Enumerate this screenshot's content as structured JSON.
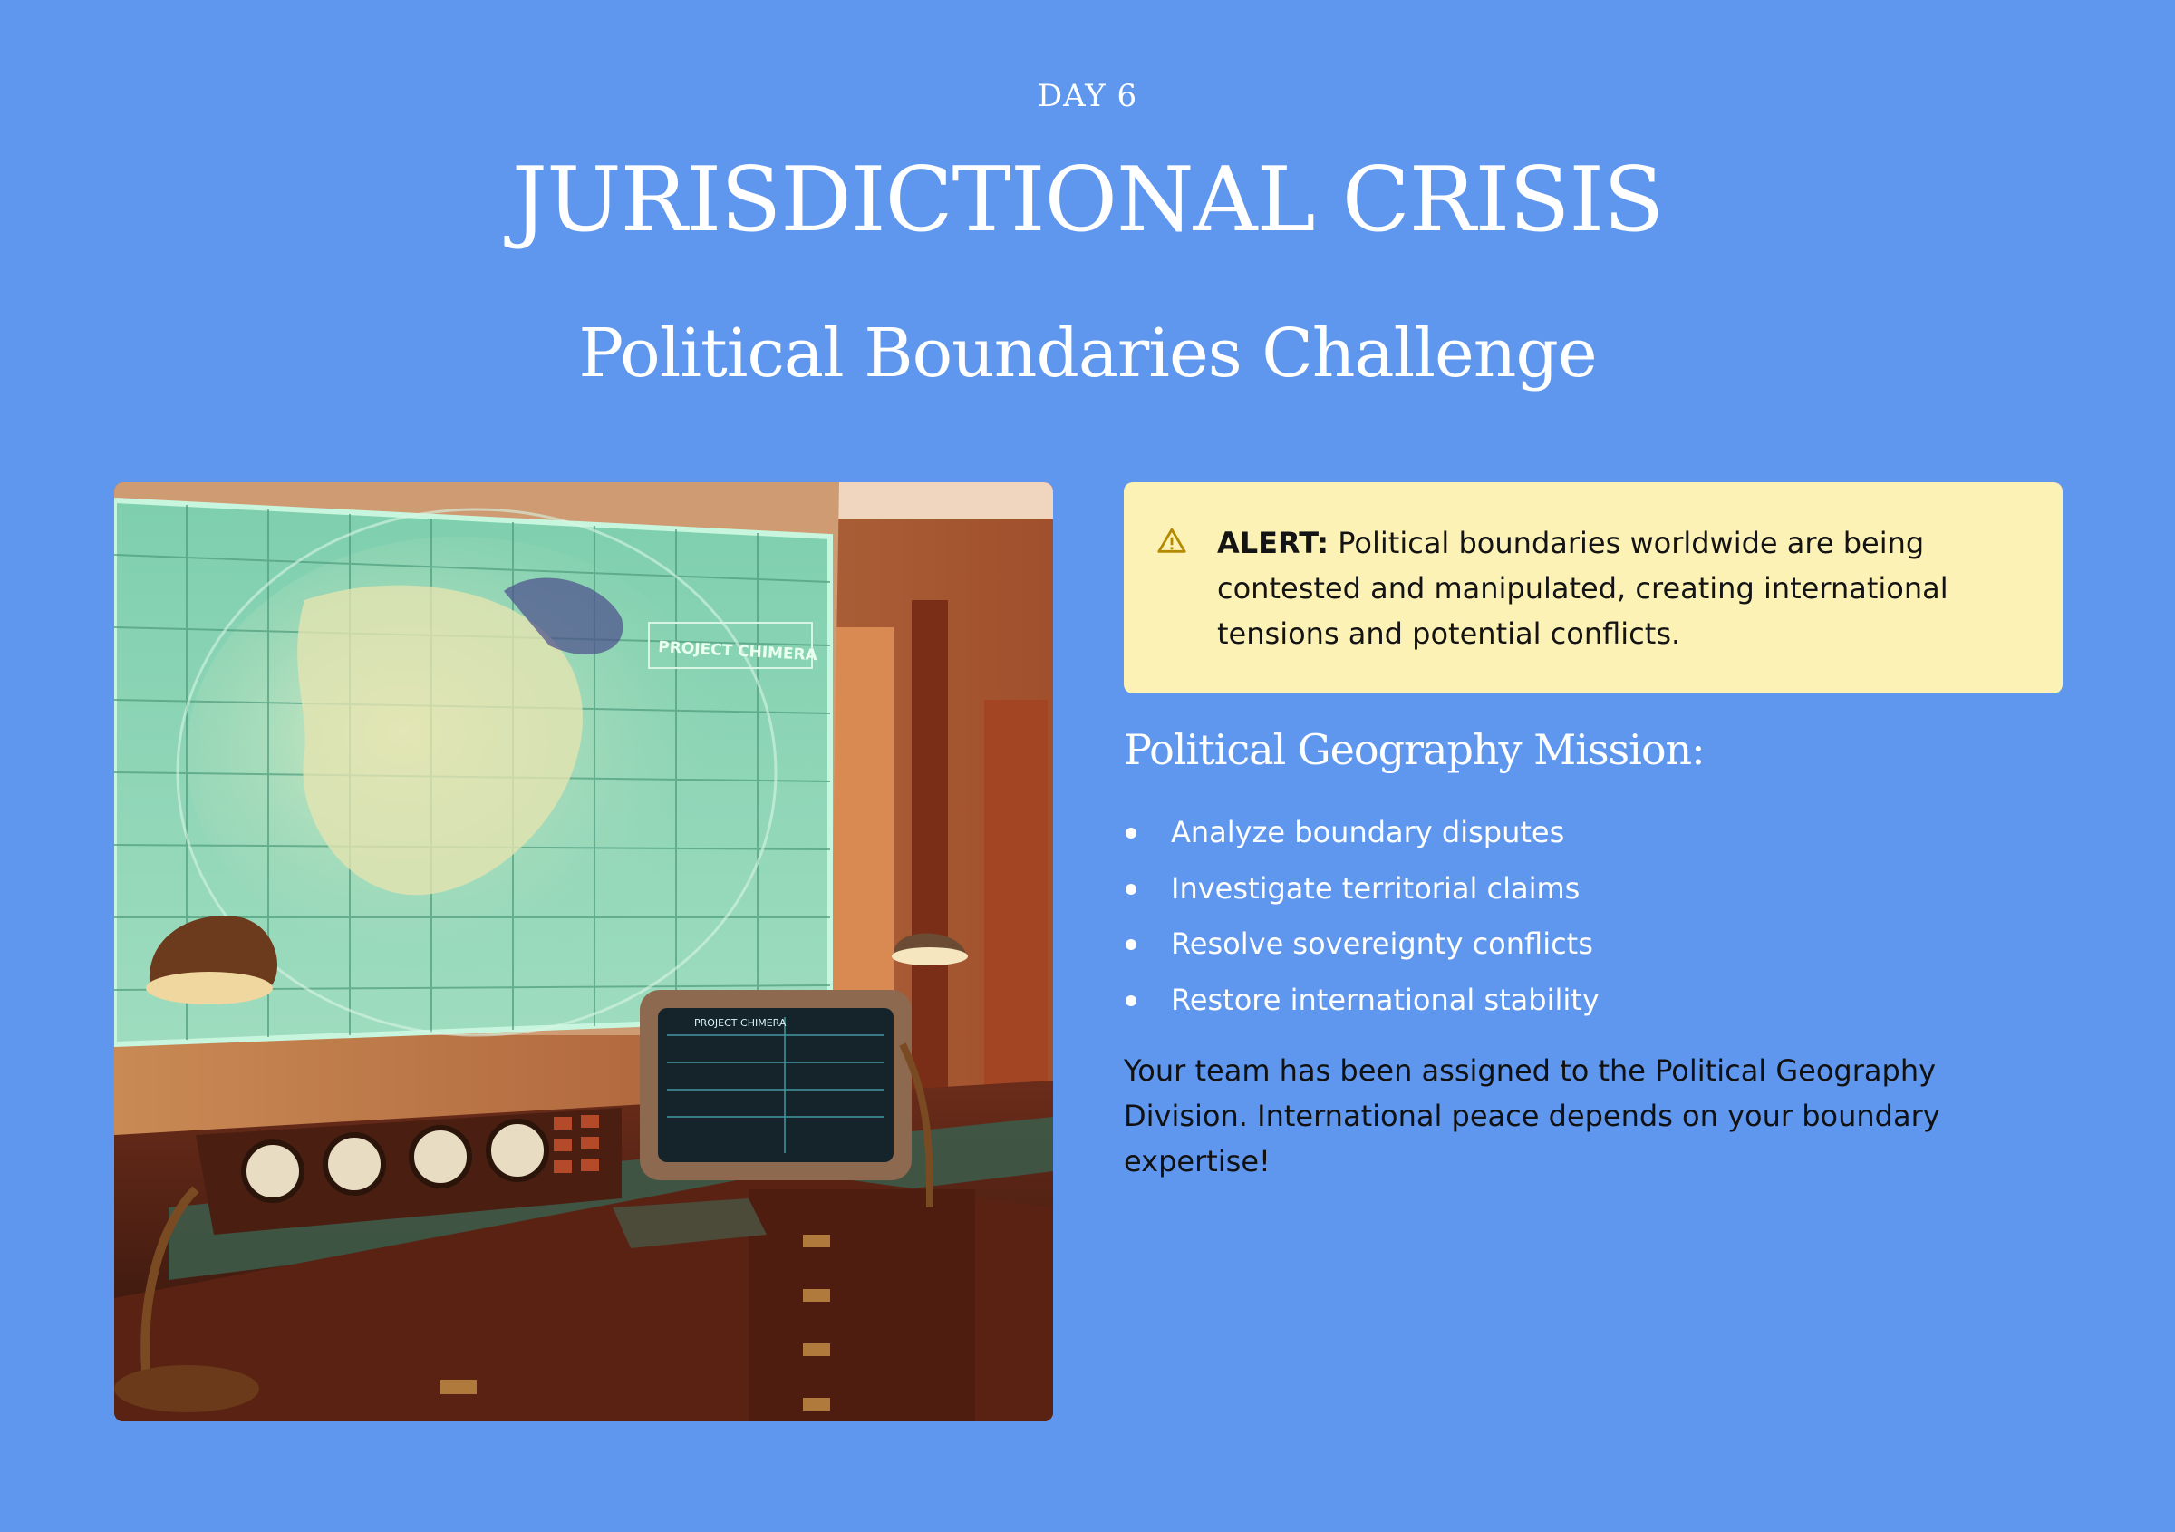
{
  "header": {
    "day_label": "DAY 6",
    "title": "JURISDICTIONAL CRISIS",
    "subtitle": "Political Boundaries Challenge"
  },
  "scene": {
    "map_overlay_text": "PROJECT CHIMERA",
    "monitor_text": "PROJECT CHIMERA"
  },
  "alert": {
    "icon": "warning-icon",
    "label": "ALERT:",
    "text": " Political boundaries worldwide are being contested and manipulated, creating international tensions and potential conflicts."
  },
  "mission": {
    "heading": "Political Geography Mission:",
    "items": [
      "Analyze boundary disputes",
      "Investigate territorial claims",
      "Resolve sovereignty conflicts",
      "Restore international stability"
    ],
    "briefing": "Your team has been assigned to the Political Geography Division. International peace depends on your boundary expertise!"
  },
  "colors": {
    "background": "#5f97ef",
    "alert_bg": "#fdf2b6",
    "alert_icon": "#b38a00"
  }
}
